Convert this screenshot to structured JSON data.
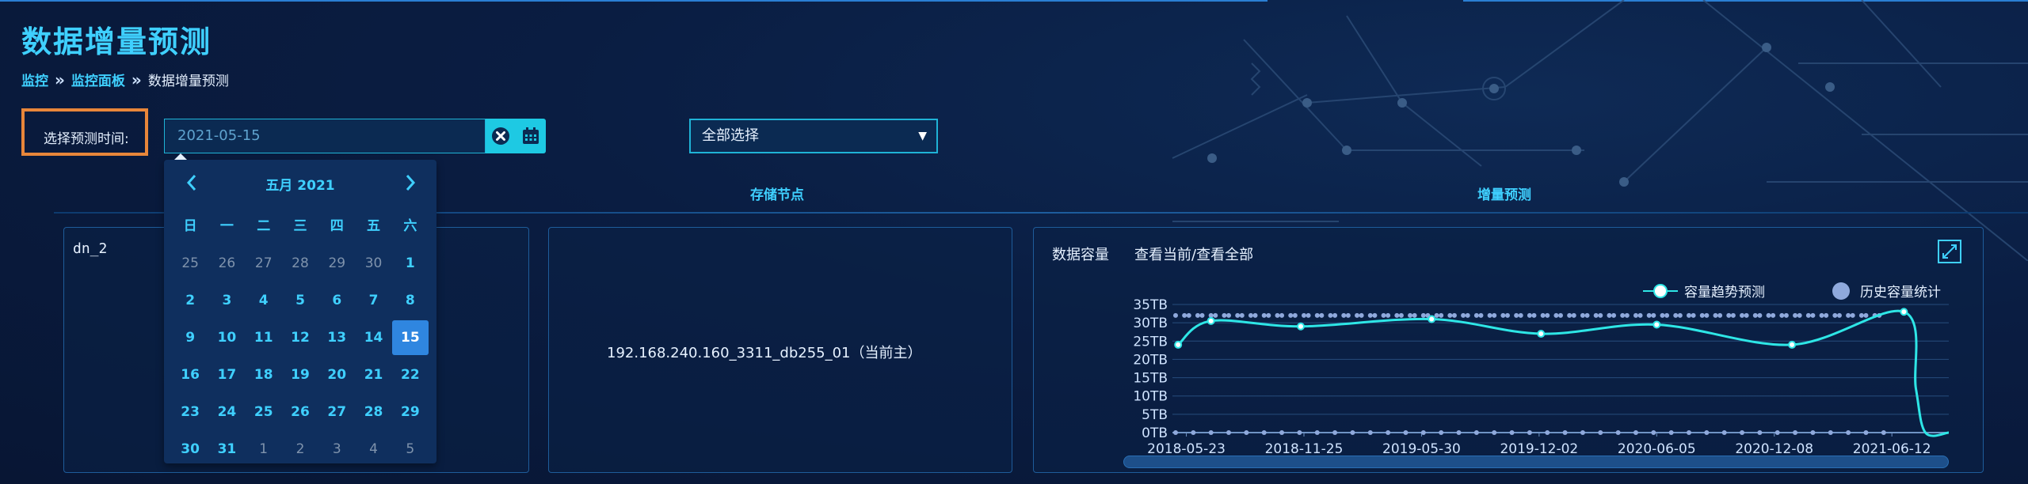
{
  "page": {
    "title": "数据增量预测"
  },
  "breadcrumb": {
    "items": [
      "监控",
      "监控面板"
    ],
    "current": "数据增量预测"
  },
  "filter": {
    "time_label": "选择预测时间:",
    "date_value": "2021-05-15",
    "select_value": "全部选择"
  },
  "columns": {
    "storage_node": "存储节点",
    "growth_forecast": "增量预测"
  },
  "panels": {
    "dn_name": "dn_2",
    "node_name": "192.168.240.160_3311_db255_01（当前主）"
  },
  "chart_panel": {
    "title": "数据容量",
    "link": "查看当前/查看全部"
  },
  "legend": {
    "trend": "容量趋势预测",
    "history": "历史容量统计"
  },
  "colors": {
    "accent": "#3fd0ff",
    "trend_line": "#2ee6e6",
    "history_dot": "#8fa9dc",
    "selected_day": "#2f86e0",
    "orange_highlight": "#e8863a"
  },
  "calendar": {
    "month_label": "五月 2021",
    "weekdays": [
      "日",
      "一",
      "二",
      "三",
      "四",
      "五",
      "六"
    ],
    "weeks": [
      [
        "25",
        "26",
        "27",
        "28",
        "29",
        "30",
        "1"
      ],
      [
        "2",
        "3",
        "4",
        "5",
        "6",
        "7",
        "8"
      ],
      [
        "9",
        "10",
        "11",
        "12",
        "13",
        "14",
        "15"
      ],
      [
        "16",
        "17",
        "18",
        "19",
        "20",
        "21",
        "22"
      ],
      [
        "23",
        "24",
        "25",
        "26",
        "27",
        "28",
        "29"
      ],
      [
        "30",
        "31",
        "1",
        "2",
        "3",
        "4",
        "5"
      ]
    ],
    "muted_first_row_count": 6,
    "muted_last_row_from": 2,
    "selected_day": "15"
  },
  "icons": {
    "clear": "close-circle-icon",
    "calendar": "calendar-icon",
    "prev": "chevron-left-icon",
    "next": "chevron-right-icon",
    "expand": "expand-icon",
    "dropdown": "caret-down-icon"
  },
  "chart_data": {
    "type": "line",
    "y_ticks": [
      "0TB",
      "5TB",
      "10TB",
      "15TB",
      "20TB",
      "25TB",
      "30TB",
      "35TB"
    ],
    "ylim": [
      0,
      35
    ],
    "x_ticks": [
      "2018-05-23",
      "2018-11-25",
      "2019-05-30",
      "2019-12-02",
      "2020-06-05",
      "2020-12-08",
      "2021-06-12"
    ],
    "xlim": [
      "2018-05-01",
      "2021-09-10"
    ],
    "grid": true,
    "legend_position": "top-right",
    "series": [
      {
        "name": "容量趋势预测",
        "points": [
          [
            "2018-05-10",
            24
          ],
          [
            "2018-07-01",
            30.5
          ],
          [
            "2018-11-20",
            29
          ],
          [
            "2019-06-15",
            31
          ],
          [
            "2019-12-05",
            27
          ],
          [
            "2020-06-05",
            29.5
          ],
          [
            "2021-01-05",
            24
          ],
          [
            "2021-07-01",
            33
          ],
          [
            "2021-07-20",
            12
          ],
          [
            "2021-08-04",
            0
          ],
          [
            "2021-09-10",
            0
          ]
        ]
      }
    ],
    "history_top_band_y": 32,
    "history_bottom_band_y": 0
  }
}
